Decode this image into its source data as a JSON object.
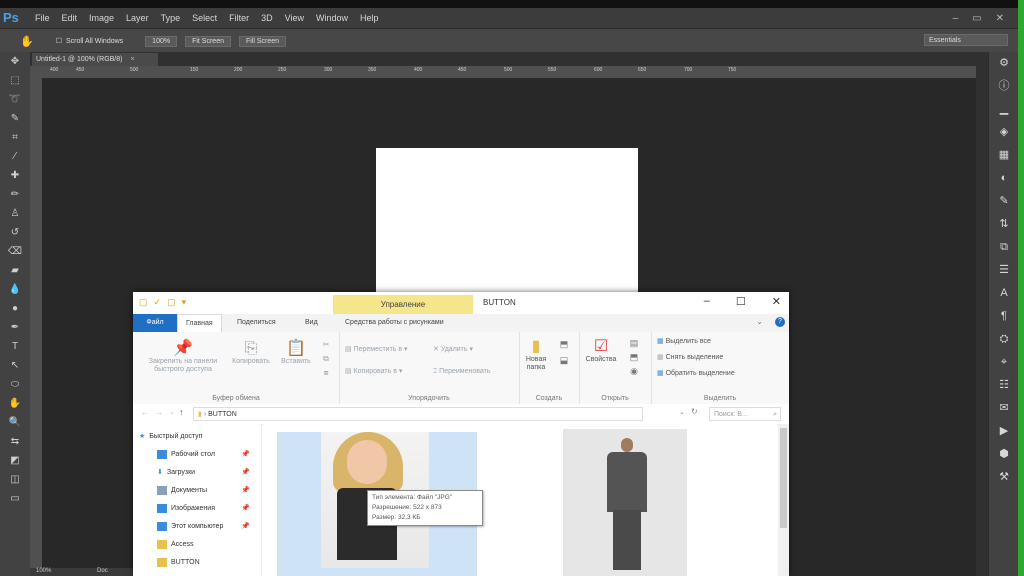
{
  "photoshop": {
    "logo": "Ps",
    "menu": [
      "File",
      "Edit",
      "Image",
      "Layer",
      "Type",
      "Select",
      "Filter",
      "3D",
      "View",
      "Window",
      "Help"
    ],
    "window_controls": [
      "–",
      "▭",
      "✕"
    ],
    "options": {
      "scroll_all": "Scroll All Windows",
      "zoom": "100%",
      "fit_screen": "Fit Screen",
      "fill_screen": "Fill Screen",
      "workspace": "Essentials"
    },
    "doc_tab": "Untitled-1 @ 100% (RGB/8)",
    "ruler_ticks": [
      "400",
      "450",
      "500",
      "150",
      "200",
      "250",
      "300",
      "350",
      "400",
      "450",
      "500",
      "550",
      "600",
      "650",
      "700",
      "750"
    ],
    "status_zoom": "100%",
    "status_doc": "Doc"
  },
  "explorer": {
    "quick_access": [
      "▢",
      "✓",
      "▢",
      "▾"
    ],
    "context_tab": "Управление",
    "title": "BUTTON",
    "window_controls": [
      "–",
      "☐",
      "✕"
    ],
    "tabs": {
      "file": "Файл",
      "home": "Главная",
      "share": "Поделиться",
      "view": "Вид",
      "tools": "Средства работы с рисунками"
    },
    "ribbon": {
      "clipboard": {
        "pin": "Закрепить на панели быстрого доступа",
        "copy": "Копировать",
        "paste": "Вставить",
        "label": "Буфер обмена"
      },
      "organize": {
        "move": "Переместить в ▾",
        "delete": "Удалить ▾",
        "copy_to": "Копировать в ▾",
        "rename": "Переименовать",
        "label": "Упорядочить"
      },
      "new": {
        "new_folder": "Новая папка",
        "label": "Создать"
      },
      "open": {
        "properties": "Свойства",
        "label": "Открыть"
      },
      "select": {
        "all": "Выделить все",
        "none": "Снять выделение",
        "invert": "Обратить выделение",
        "label": "Выделить"
      }
    },
    "address": {
      "path": "BUTTON",
      "search_placeholder": "Поиск: B..."
    },
    "nav": [
      {
        "label": "Быстрый доступ",
        "color": "#3a8ddb"
      },
      {
        "label": "Рабочий стол",
        "color": "#3a8ddb"
      },
      {
        "label": "Загрузки",
        "color": "#3a8ddb"
      },
      {
        "label": "Документы",
        "color": "#8aa0b8"
      },
      {
        "label": "Изображения",
        "color": "#3a8ddb"
      },
      {
        "label": "Этот компьютер",
        "color": "#3a8ddb"
      },
      {
        "label": "Access",
        "color": "#e8c050"
      },
      {
        "label": "BUTTON",
        "color": "#e8c050"
      }
    ],
    "tooltip": {
      "type": "Тип элемента: Файл \"JPG\"",
      "resolution": "Разрешение: 522 x 873",
      "size": "Размер: 32,3 КБ"
    }
  }
}
